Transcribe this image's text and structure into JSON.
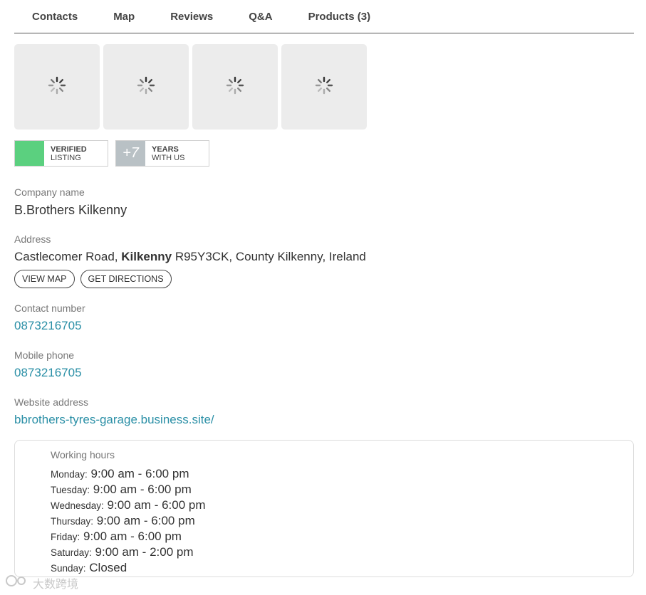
{
  "tabs": [
    {
      "label": "Contacts"
    },
    {
      "label": "Map"
    },
    {
      "label": "Reviews"
    },
    {
      "label": "Q&A"
    },
    {
      "label": "Products (3)"
    }
  ],
  "thumbnails": [
    {
      "icon": "loading-spinner-icon"
    },
    {
      "icon": "loading-spinner-icon"
    },
    {
      "icon": "loading-spinner-icon"
    },
    {
      "icon": "loading-spinner-icon"
    }
  ],
  "badges": {
    "verified": {
      "line1": "VERIFIED",
      "line2": "LISTING",
      "color": "#5bd07f"
    },
    "years": {
      "number": "+7",
      "line1": "YEARS",
      "line2": "WITH US",
      "color": "#b9c1c5"
    }
  },
  "company": {
    "label": "Company name",
    "value": "B.Brothers Kilkenny"
  },
  "address": {
    "label": "Address",
    "part1": "Castlecomer Road, ",
    "city": "Kilkenny",
    "part2": " R95Y3CK, County Kilkenny, Ireland",
    "view_map": "VIEW MAP",
    "get_directions": "GET DIRECTIONS"
  },
  "contact": {
    "label": "Contact number",
    "value": "0873216705"
  },
  "mobile": {
    "label": "Mobile phone",
    "value": "0873216705"
  },
  "website": {
    "label": "Website address",
    "value": "bbrothers-tyres-garage.business.site/"
  },
  "hours": {
    "title": "Working hours",
    "days": [
      {
        "day": "Monday:",
        "time": "9:00 am - 6:00 pm"
      },
      {
        "day": "Tuesday:",
        "time": "9:00 am - 6:00 pm"
      },
      {
        "day": "Wednesday:",
        "time": "9:00 am - 6:00 pm"
      },
      {
        "day": "Thursday:",
        "time": "9:00 am - 6:00 pm"
      },
      {
        "day": "Friday:",
        "time": "9:00 am - 6:00 pm"
      },
      {
        "day": "Saturday:",
        "time": "9:00 am - 2:00 pm"
      },
      {
        "day": "Sunday:",
        "time": "Closed"
      }
    ]
  },
  "watermark": {
    "text": "大数跨境",
    "color": "#bbbbbb"
  },
  "colors": {
    "link": "#2a8fa6",
    "text": "#333333",
    "label": "#777777"
  }
}
